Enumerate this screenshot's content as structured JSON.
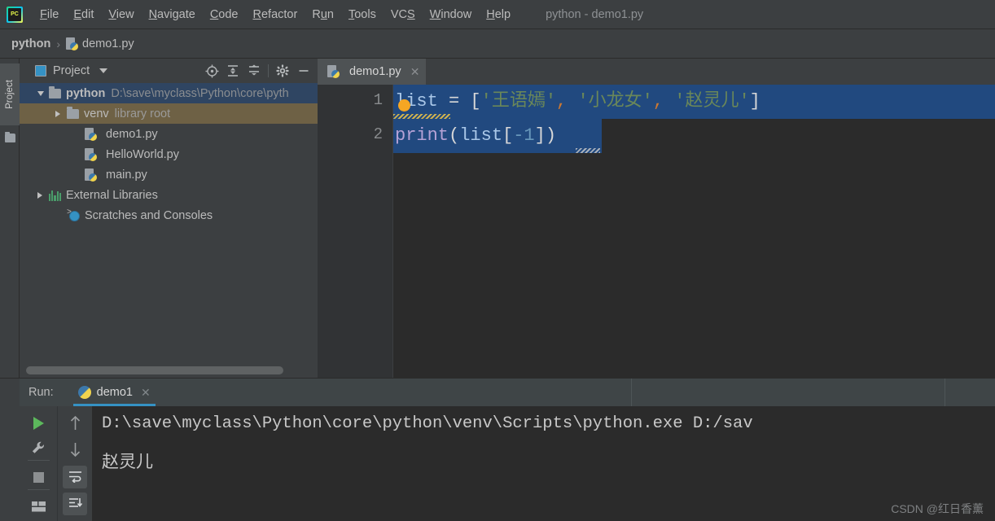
{
  "window": {
    "title": "python - demo1.py",
    "logo_icon": "pycharm-logo-icon"
  },
  "menubar": {
    "items": [
      {
        "label": "File",
        "accel": "F"
      },
      {
        "label": "Edit",
        "accel": "E"
      },
      {
        "label": "View",
        "accel": "V"
      },
      {
        "label": "Navigate",
        "accel": "N"
      },
      {
        "label": "Code",
        "accel": "C"
      },
      {
        "label": "Refactor",
        "accel": "R"
      },
      {
        "label": "Run",
        "accel": "u"
      },
      {
        "label": "Tools",
        "accel": "T"
      },
      {
        "label": "VCS",
        "accel": "S"
      },
      {
        "label": "Window",
        "accel": "W"
      },
      {
        "label": "Help",
        "accel": "H"
      }
    ]
  },
  "breadcrumb": {
    "root": "python",
    "separator": "›",
    "file": "demo1.py",
    "file_icon": "python-file-icon"
  },
  "left_strip": {
    "tab_label": "Project",
    "folder_icon": "folder-icon"
  },
  "project_panel": {
    "title": "Project",
    "panel_icon": "project-panel-icon",
    "dropdown_icon": "chevron-down-icon",
    "toolbar_icons": [
      "locate-target-icon",
      "expand-all-icon",
      "collapse-all-icon",
      "settings-gear-icon",
      "minimize-icon"
    ],
    "tree": [
      {
        "name": "python",
        "detail": "D:\\save\\myclass\\Python\\core\\pyth",
        "icon": "folder-icon",
        "indent": 0,
        "arrow": "open",
        "state": "selected-blue",
        "bold": true
      },
      {
        "name": "venv",
        "detail": "library root",
        "icon": "folder-icon",
        "indent": 1,
        "arrow": "collapsed",
        "state": "selected-olive",
        "bold": false
      },
      {
        "name": "demo1.py",
        "detail": "",
        "icon": "python-file-icon",
        "indent": 2,
        "arrow": "none",
        "state": "none",
        "bold": false
      },
      {
        "name": "HelloWorld.py",
        "detail": "",
        "icon": "python-file-icon",
        "indent": 2,
        "arrow": "none",
        "state": "none",
        "bold": false
      },
      {
        "name": "main.py",
        "detail": "",
        "icon": "python-file-icon",
        "indent": 2,
        "arrow": "none",
        "state": "none",
        "bold": false
      },
      {
        "name": "External Libraries",
        "detail": "",
        "icon": "libraries-icon",
        "indent": 0,
        "arrow": "collapsed",
        "state": "none",
        "bold": false
      },
      {
        "name": "Scratches and Consoles",
        "detail": "",
        "icon": "scratches-icon",
        "indent": 1,
        "arrow": "none",
        "state": "none",
        "bold": false
      }
    ]
  },
  "editor": {
    "tab": {
      "label": "demo1.py",
      "icon": "python-file-icon",
      "close_icon": "close-icon"
    },
    "line_numbers": [
      "1",
      "2"
    ],
    "inspection_icon": "intention-bulb-icon",
    "lines": [
      {
        "number": "1",
        "selected": true,
        "tokens": [
          {
            "t": "list",
            "k": "ident"
          },
          {
            "t": " = ",
            "k": "plain"
          },
          {
            "t": "[",
            "k": "plain"
          },
          {
            "t": "'王语嫣'",
            "k": "str"
          },
          {
            "t": ",",
            "k": "comma"
          },
          {
            "t": " ",
            "k": "plain"
          },
          {
            "t": "'小龙女'",
            "k": "str"
          },
          {
            "t": ",",
            "k": "comma"
          },
          {
            "t": " ",
            "k": "plain"
          },
          {
            "t": "'赵灵儿'",
            "k": "str"
          },
          {
            "t": "]",
            "k": "plain"
          }
        ]
      },
      {
        "number": "2",
        "selected": true,
        "tokens": [
          {
            "t": "print",
            "k": "func"
          },
          {
            "t": "(",
            "k": "plain"
          },
          {
            "t": "list",
            "k": "ident"
          },
          {
            "t": "[",
            "k": "plain"
          },
          {
            "t": "-1",
            "k": "num"
          },
          {
            "t": "]",
            "k": "plain"
          },
          {
            "t": ")",
            "k": "plain"
          }
        ]
      }
    ],
    "raw_text": [
      "list = ['王语嫣', '小龙女', '赵灵儿']",
      "print(list[-1])"
    ]
  },
  "run_panel": {
    "label": "Run:",
    "tab": {
      "label": "demo1",
      "icon": "python-run-icon",
      "close_icon": "close-icon"
    },
    "toolbar_left": [
      "run-play-icon",
      "wrench-settings-icon",
      "stop-icon",
      "layout-icon"
    ],
    "toolbar_right": [
      "up-arrow-icon",
      "down-arrow-icon",
      "soft-wrap-icon",
      "scroll-to-end-icon"
    ],
    "console": {
      "command": "D:\\save\\myclass\\Python\\core\\python\\venv\\Scripts\\python.exe D:/sav",
      "output": "赵灵儿"
    }
  },
  "watermark": {
    "text": "CSDN @红日香薰"
  },
  "colors": {
    "chrome_bg": "#3c3f41",
    "editor_bg": "#2b2b2b",
    "gutter_bg": "#313335",
    "selection_blue": "#21497f",
    "tree_selected_blue": "#2f4562",
    "tree_hover_olive": "#6e6145",
    "accent_blue": "#3592c4",
    "string_green": "#6a8759",
    "comma_orange": "#cc7832",
    "bulb_orange": "#f5a623",
    "play_green": "#5cb85c"
  }
}
